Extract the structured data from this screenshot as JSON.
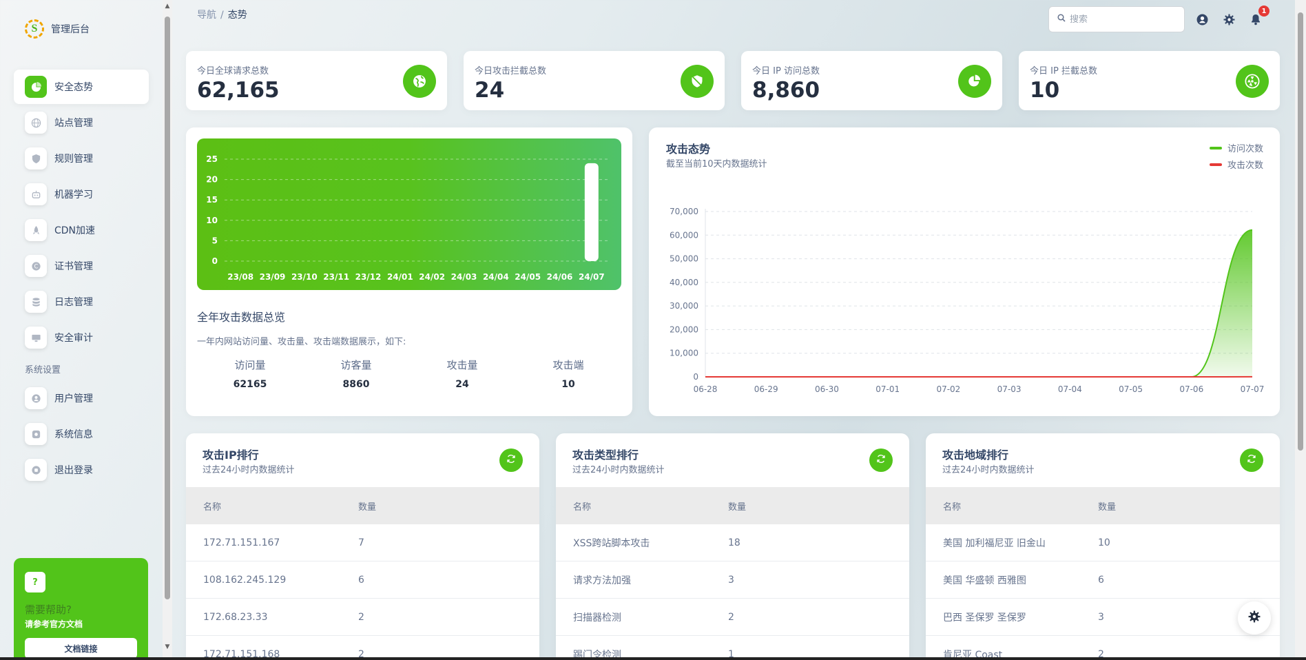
{
  "brand": {
    "logo_letter": "S",
    "title": "管理后台"
  },
  "nav": {
    "items": [
      {
        "label": "安全态势",
        "icon": "pie-chart-icon",
        "active": true
      },
      {
        "label": "站点管理",
        "icon": "globe-icon"
      },
      {
        "label": "规则管理",
        "icon": "shield-icon"
      },
      {
        "label": "机器学习",
        "icon": "robot-icon"
      },
      {
        "label": "CDN加速",
        "icon": "rocket-icon"
      },
      {
        "label": "证书管理",
        "icon": "certificate-icon"
      },
      {
        "label": "日志管理",
        "icon": "database-icon"
      },
      {
        "label": "安全审计",
        "icon": "monitor-icon"
      }
    ],
    "section_label": "系统设置",
    "system_items": [
      {
        "label": "用户管理",
        "icon": "user-icon"
      },
      {
        "label": "系统信息",
        "icon": "info-icon"
      },
      {
        "label": "退出登录",
        "icon": "logout-icon"
      }
    ]
  },
  "help": {
    "icon_text": "?",
    "title": "需要帮助?",
    "subtitle": "请参考官方文档",
    "button_label": "文档链接"
  },
  "breadcrumb": {
    "root": "导航",
    "separator": "/",
    "current": "态势"
  },
  "search": {
    "placeholder": "搜索",
    "value": ""
  },
  "notifications": {
    "count": "1"
  },
  "stats": [
    {
      "label": "今日全球请求总数",
      "value": "62,165",
      "icon": "globe-icon"
    },
    {
      "label": "今日攻击拦截总数",
      "value": "24",
      "icon": "shield-icon"
    },
    {
      "label": "今日 IP 访问总数",
      "value": "8,860",
      "icon": "pie-chart-icon"
    },
    {
      "label": "今日 IP 拦截总数",
      "value": "10",
      "icon": "radiation-icon"
    }
  ],
  "overview": {
    "title": "全年攻击数据总览",
    "description": "一年内网站访问量、攻击量、攻击端数据展示，如下:",
    "columns": [
      {
        "label": "访问量",
        "value": "62165"
      },
      {
        "label": "访客量",
        "value": "8860"
      },
      {
        "label": "攻击量",
        "value": "24"
      },
      {
        "label": "攻击端",
        "value": "10"
      }
    ]
  },
  "chart_data": [
    {
      "type": "bar",
      "categories": [
        "23/08",
        "23/09",
        "23/10",
        "23/11",
        "23/12",
        "24/01",
        "24/02",
        "24/03",
        "24/04",
        "24/05",
        "24/06",
        "24/07"
      ],
      "values": [
        0,
        0,
        0,
        0,
        0,
        0,
        0,
        0,
        0,
        0,
        0,
        24
      ],
      "yticks": [
        "0",
        "5",
        "10",
        "15",
        "20",
        "25"
      ],
      "ylim": [
        0,
        25
      ],
      "grid": true,
      "bar_color": "#ffffff"
    },
    {
      "type": "area",
      "title": "攻击态势",
      "subtitle": "截至当前10天内数据统计",
      "categories": [
        "06-28",
        "06-29",
        "06-30",
        "07-01",
        "07-02",
        "07-03",
        "07-04",
        "07-05",
        "07-06",
        "07-07"
      ],
      "series": [
        {
          "name": "访问次数",
          "color": "#52c41a",
          "values": [
            0,
            0,
            0,
            0,
            0,
            0,
            0,
            0,
            0,
            62165
          ]
        },
        {
          "name": "攻击次数",
          "color": "#e53935",
          "values": [
            0,
            0,
            0,
            0,
            0,
            0,
            0,
            0,
            0,
            24
          ]
        }
      ],
      "yticks": [
        "0",
        "10,000",
        "20,000",
        "30,000",
        "40,000",
        "50,000",
        "60,000",
        "70,000"
      ],
      "ylim": [
        0,
        70000
      ],
      "grid": true,
      "legend_position": "top-right"
    }
  ],
  "rankings": [
    {
      "title": "攻击IP排行",
      "subtitle": "过去24小时内数据统计",
      "headers": [
        "名称",
        "数量"
      ],
      "rows": [
        [
          "172.71.151.167",
          "7"
        ],
        [
          "108.162.245.129",
          "6"
        ],
        [
          "172.68.23.33",
          "2"
        ],
        [
          "172.71.151.168",
          "2"
        ]
      ]
    },
    {
      "title": "攻击类型排行",
      "subtitle": "过去24小时内数据统计",
      "headers": [
        "名称",
        "数量"
      ],
      "rows": [
        [
          "XSS跨站脚本攻击",
          "18"
        ],
        [
          "请求方法加强",
          "3"
        ],
        [
          "扫描器检测",
          "2"
        ],
        [
          "踢门令检测",
          "1"
        ]
      ]
    },
    {
      "title": "攻击地域排行",
      "subtitle": "过去24小时内数据统计",
      "headers": [
        "名称",
        "数量"
      ],
      "rows": [
        [
          "美国 加利福尼亚 旧金山",
          "10"
        ],
        [
          "美国 华盛顿 西雅图",
          "6"
        ],
        [
          "巴西 圣保罗 圣保罗",
          "3"
        ],
        [
          "肯尼亚 Coast",
          "2"
        ]
      ]
    }
  ],
  "colors": {
    "accent": "#52c41a",
    "danger": "#e53935",
    "text": "#344767"
  }
}
